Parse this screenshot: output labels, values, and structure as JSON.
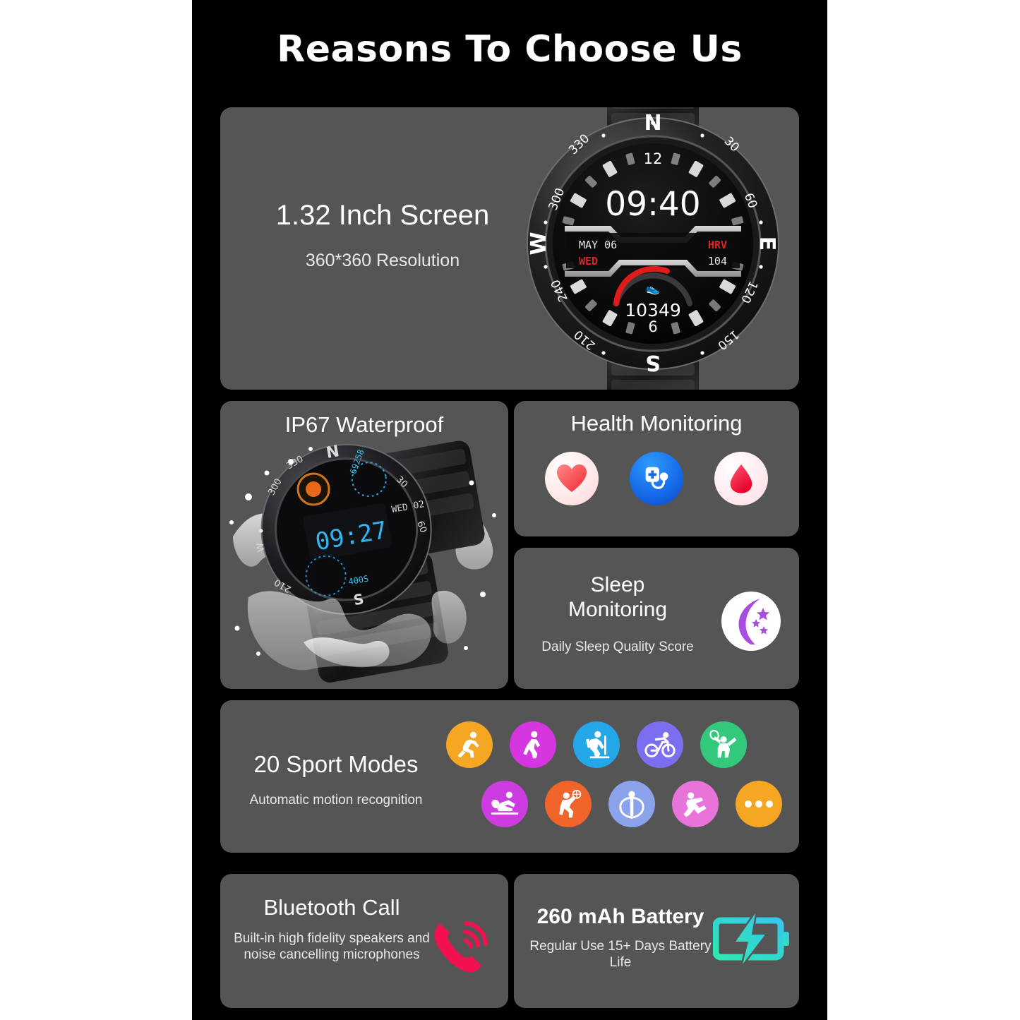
{
  "page": {
    "title": "Reasons To Choose Us",
    "background": "#000000",
    "card_background": "#555555"
  },
  "cards": {
    "screen": {
      "title": "1.32 Inch Screen",
      "subtitle": "360*360 Resolution",
      "watch_face": {
        "time": "09:40",
        "date": "MAY  06",
        "weekday": "WED",
        "hrv_label": "HRV",
        "hrv_value": "104",
        "steps": "10349",
        "hour_top": "12",
        "hour_bottom": "6",
        "bezel_north": "N",
        "bezel_east": "E",
        "bezel_south": "S",
        "bezel_west": "W",
        "bezel_degrees": [
          "30",
          "60",
          "120",
          "150",
          "210",
          "240",
          "300",
          "330"
        ],
        "accent_color": "#e01b1b"
      }
    },
    "waterproof": {
      "title": "IP67 Waterproof",
      "watch_face": {
        "time": "09:27",
        "date": "WED 02",
        "steps": "69258",
        "calories": "400S",
        "accent_color": "#29b6e8"
      }
    },
    "health": {
      "title": "Health Monitoring",
      "icons": [
        {
          "name": "heart-rate-icon",
          "glyph": "heart",
          "circle_color": "#ffffff",
          "glyph_color": "#f4474c"
        },
        {
          "name": "blood-pressure-icon",
          "glyph": "stethoscope",
          "circle_color": "#1570ef",
          "glyph_color": "#ffffff"
        },
        {
          "name": "blood-oxygen-icon",
          "glyph": "drop",
          "circle_color": "#ffffff",
          "glyph_color": "#f0203c"
        }
      ]
    },
    "sleep": {
      "title_line1": "Sleep",
      "title_line2": "Monitoring",
      "subtitle": "Daily Sleep Quality Score",
      "icon": {
        "name": "moon-stars-icon",
        "circle_color": "#ffffff",
        "glyph_color": "#a94ce0"
      }
    },
    "sport": {
      "title": "20 Sport Modes",
      "subtitle": "Automatic motion recognition",
      "icons_row1": [
        {
          "name": "running-icon",
          "color": "#f5a623"
        },
        {
          "name": "walking-icon",
          "color": "#d636e0"
        },
        {
          "name": "climbing-icon",
          "color": "#23a7e8"
        },
        {
          "name": "cycling-icon",
          "color": "#7b6ef0"
        },
        {
          "name": "badminton-icon",
          "color": "#32c97d"
        }
      ],
      "icons_row2": [
        {
          "name": "table-tennis-icon",
          "color": "#cc3ce0"
        },
        {
          "name": "basketball-icon",
          "color": "#f0642a"
        },
        {
          "name": "skipping-rope-icon",
          "color": "#8ba3ea"
        },
        {
          "name": "yoga-icon",
          "color": "#e873d9"
        },
        {
          "name": "more-modes-icon",
          "color": "#f5a623"
        }
      ]
    },
    "bluetooth": {
      "title": "Bluetooth Call",
      "subtitle": "Built-in high fidelity speakers and noise cancelling microphones",
      "icon": {
        "name": "phone-ringing-icon",
        "color": "#f2114e"
      }
    },
    "battery": {
      "title": "260 mAh Battery",
      "subtitle": "Regular Use 15+ Days Battery Life",
      "icon": {
        "name": "battery-charging-icon",
        "color_start": "#2de8b0",
        "color_end": "#35c6ee"
      }
    }
  }
}
